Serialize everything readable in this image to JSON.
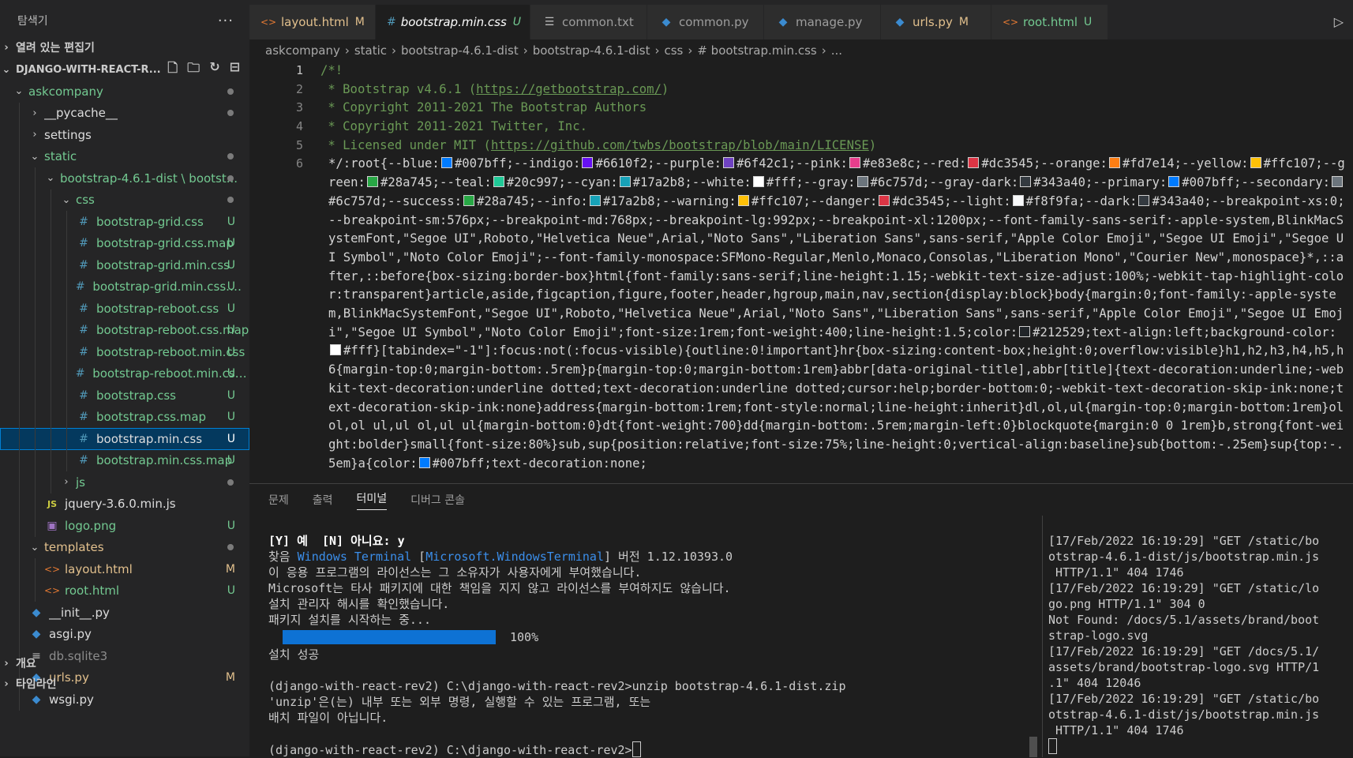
{
  "explorer": {
    "title": "탐색기",
    "more": "···",
    "open_editors": "열려 있는 편집기",
    "project": "DJANGO-WITH-REACT-R...",
    "outline": "개요",
    "timeline": "타임라인"
  },
  "tree": [
    {
      "label": "askcompany",
      "depth": 0,
      "kind": "folder-open",
      "color": "c-green",
      "status": "dot"
    },
    {
      "label": "__pycache__",
      "depth": 1,
      "kind": "folder",
      "color": "c-white",
      "status": "dot"
    },
    {
      "label": "settings",
      "depth": 1,
      "kind": "folder",
      "color": "c-white",
      "status": ""
    },
    {
      "label": "static",
      "depth": 1,
      "kind": "folder-open",
      "color": "c-green",
      "status": "dot"
    },
    {
      "label": "bootstrap-4.6.1-dist \\ bootst...",
      "depth": 2,
      "kind": "folder-open",
      "color": "c-green",
      "status": "dot"
    },
    {
      "label": "css",
      "depth": 3,
      "kind": "folder-open",
      "color": "c-green",
      "status": "dot"
    },
    {
      "label": "bootstrap-grid.css",
      "depth": 4,
      "kind": "css",
      "color": "c-green",
      "status": "U"
    },
    {
      "label": "bootstrap-grid.css.map",
      "depth": 4,
      "kind": "css",
      "color": "c-green",
      "status": "U"
    },
    {
      "label": "bootstrap-grid.min.css",
      "depth": 4,
      "kind": "css",
      "color": "c-green",
      "status": "U"
    },
    {
      "label": "bootstrap-grid.min.css.map",
      "depth": 4,
      "kind": "css",
      "color": "c-green",
      "status": "U"
    },
    {
      "label": "bootstrap-reboot.css",
      "depth": 4,
      "kind": "css",
      "color": "c-green",
      "status": "U"
    },
    {
      "label": "bootstrap-reboot.css.map",
      "depth": 4,
      "kind": "css",
      "color": "c-green",
      "status": "U"
    },
    {
      "label": "bootstrap-reboot.min.css",
      "depth": 4,
      "kind": "css",
      "color": "c-green",
      "status": "U"
    },
    {
      "label": "bootstrap-reboot.min.css....",
      "depth": 4,
      "kind": "css",
      "color": "c-green",
      "status": "U"
    },
    {
      "label": "bootstrap.css",
      "depth": 4,
      "kind": "css",
      "color": "c-green",
      "status": "U"
    },
    {
      "label": "bootstrap.css.map",
      "depth": 4,
      "kind": "css",
      "color": "c-green",
      "status": "U"
    },
    {
      "label": "bootstrap.min.css",
      "depth": 4,
      "kind": "css",
      "color": "c-white",
      "status": "U",
      "selected": true
    },
    {
      "label": "bootstrap.min.css.map",
      "depth": 4,
      "kind": "css",
      "color": "c-green",
      "status": "U"
    },
    {
      "label": "js",
      "depth": 3,
      "kind": "folder",
      "color": "c-green",
      "status": "dot"
    },
    {
      "label": "jquery-3.6.0.min.js",
      "depth": 2,
      "kind": "js",
      "color": "c-white",
      "status": ""
    },
    {
      "label": "logo.png",
      "depth": 2,
      "kind": "img",
      "color": "c-green",
      "status": "U"
    },
    {
      "label": "templates",
      "depth": 1,
      "kind": "folder-open",
      "color": "c-gold",
      "status": "dot"
    },
    {
      "label": "layout.html",
      "depth": 2,
      "kind": "html",
      "color": "c-gold",
      "status": "M"
    },
    {
      "label": "root.html",
      "depth": 2,
      "kind": "html",
      "color": "c-green",
      "status": "U"
    },
    {
      "label": "__init__.py",
      "depth": 1,
      "kind": "py",
      "color": "c-white",
      "status": ""
    },
    {
      "label": "asgi.py",
      "depth": 1,
      "kind": "py",
      "color": "c-white",
      "status": ""
    },
    {
      "label": "db.sqlite3",
      "depth": 1,
      "kind": "db",
      "color": "c-dim",
      "status": ""
    },
    {
      "label": "urls.py",
      "depth": 1,
      "kind": "py",
      "color": "c-gold",
      "status": "M"
    },
    {
      "label": "wsgi.py",
      "depth": 1,
      "kind": "py",
      "color": "c-white",
      "status": ""
    }
  ],
  "tabs": [
    {
      "label": "layout.html",
      "icon": "html",
      "status": "M",
      "color": "c-gold"
    },
    {
      "label": "bootstrap.min.css",
      "icon": "css",
      "status": "U",
      "color": "c-green",
      "active": true
    },
    {
      "label": "common.txt",
      "icon": "txt",
      "status": "",
      "color": ""
    },
    {
      "label": "common.py",
      "icon": "py",
      "status": "",
      "color": ""
    },
    {
      "label": "manage.py",
      "icon": "py",
      "status": "",
      "color": ""
    },
    {
      "label": "urls.py",
      "icon": "py",
      "status": "M",
      "color": "c-gold"
    },
    {
      "label": "root.html",
      "icon": "html",
      "status": "U",
      "color": "c-green"
    }
  ],
  "breadcrumb": [
    "askcompany",
    "static",
    "bootstrap-4.6.1-dist",
    "bootstrap-4.6.1-dist",
    "css",
    "# bootstrap.min.css",
    "..."
  ],
  "editor": {
    "line_numbers": [
      "1",
      "2",
      "3",
      "4",
      "5",
      "6"
    ],
    "comment_lines": [
      {
        "pre": "/*!",
        "url": "",
        "post": ""
      },
      {
        "pre": " * Bootstrap v4.6.1 (",
        "url": "https://getbootstrap.com/",
        "post": ")"
      },
      {
        "pre": " * Copyright 2011-2021 The Bootstrap Authors",
        "url": "",
        "post": ""
      },
      {
        "pre": " * Copyright 2011-2021 Twitter, Inc.",
        "url": "",
        "post": ""
      },
      {
        "pre": " * Licensed under MIT (",
        "url": "https://github.com/twbs/bootstrap/blob/main/LICENSE",
        "post": ")"
      }
    ],
    "line6": [
      {
        "t": "*/:root{--blue:"
      },
      {
        "c": "#007bff"
      },
      {
        "t": "#007bff;--indigo:"
      },
      {
        "c": "#6610f2"
      },
      {
        "t": "#6610f2;--purple:"
      },
      {
        "c": "#6f42c1"
      },
      {
        "t": "#6f42c1;--pink:"
      },
      {
        "c": "#e83e8c"
      },
      {
        "t": "#e83e8c;--red:"
      },
      {
        "c": "#dc3545"
      },
      {
        "t": "#dc3545;--orange:"
      },
      {
        "c": "#fd7e14"
      },
      {
        "t": "#fd7e14;--yellow:"
      },
      {
        "c": "#ffc107"
      },
      {
        "t": "#ffc107;--green:"
      },
      {
        "c": "#28a745"
      },
      {
        "t": "#28a745;--teal:"
      },
      {
        "c": "#20c997"
      },
      {
        "t": "#20c997;--cyan:"
      },
      {
        "c": "#17a2b8"
      },
      {
        "t": "#17a2b8;--white:"
      },
      {
        "c": "#ffffff"
      },
      {
        "t": "#fff;--gray:"
      },
      {
        "c": "#6c757d"
      },
      {
        "t": "#6c757d;--gray-dark:"
      },
      {
        "c": "#343a40"
      },
      {
        "t": "#343a40;--primary:"
      },
      {
        "c": "#007bff"
      },
      {
        "t": "#007bff;--secondary:"
      },
      {
        "c": "#6c757d"
      },
      {
        "t": "#6c757d;--success:"
      },
      {
        "c": "#28a745"
      },
      {
        "t": "#28a745;--info:"
      },
      {
        "c": "#17a2b8"
      },
      {
        "t": "#17a2b8;--warning:"
      },
      {
        "c": "#ffc107"
      },
      {
        "t": "#ffc107;--danger:"
      },
      {
        "c": "#dc3545"
      },
      {
        "t": "#dc3545;--light:"
      },
      {
        "c": "#f8f9fa"
      },
      {
        "t": "#f8f9fa;--dark:"
      },
      {
        "c": "#343a40"
      },
      {
        "t": "#343a40;--breakpoint-xs:0;--breakpoint-sm:576px;--breakpoint-md:768px;--breakpoint-lg:992px;--breakpoint-xl:1200px;--font-family-sans-serif:-apple-system,BlinkMacSystemFont,\"Segoe UI\",Roboto,\"Helvetica Neue\",Arial,\"Noto Sans\",\"Liberation Sans\",sans-serif,\"Apple Color Emoji\",\"Segoe UI Emoji\",\"Segoe UI Symbol\",\"Noto Color Emoji\";--font-family-monospace:SFMono-Regular,Menlo,Monaco,Consolas,\"Liberation Mono\",\"Courier New\",monospace}*,::after,::before{box-sizing:border-box}html{font-family:sans-serif;line-height:1.15;-webkit-text-size-adjust:100%;-webkit-tap-highlight-color:transparent}article,aside,figcaption,figure,footer,header,hgroup,main,nav,section{display:block}body{margin:0;font-family:-apple-system,BlinkMacSystemFont,\"Segoe UI\",Roboto,\"Helvetica Neue\",Arial,\"Noto Sans\",\"Liberation Sans\",sans-serif,\"Apple Color Emoji\",\"Segoe UI Emoji\",\"Segoe UI Symbol\",\"Noto Color Emoji\";font-size:1rem;font-weight:400;line-height:1.5;color:"
      },
      {
        "c": "#212529"
      },
      {
        "t": "#212529;text-align:left;background-color:"
      },
      {
        "c": "#ffffff"
      },
      {
        "t": "#fff}[tabindex=\"-1\"]:focus:not(:focus-visible){outline:0!important}hr{box-sizing:content-box;height:0;overflow:visible}h1,h2,h3,h4,h5,h6{margin-top:0;margin-bottom:.5rem}p{margin-top:0;margin-bottom:1rem}abbr[data-original-title],abbr[title]{text-decoration:underline;-webkit-text-decoration:underline dotted;text-decoration:underline dotted;cursor:help;border-bottom:0;-webkit-text-decoration-skip-ink:none;text-decoration-skip-ink:none}address{margin-bottom:1rem;font-style:normal;line-height:inherit}dl,ol,ul{margin-top:0;margin-bottom:1rem}ol ol,ol ul,ul ol,ul ul{margin-bottom:0}dt{font-weight:700}dd{margin-bottom:.5rem;margin-left:0}blockquote{margin:0 0 1rem}b,strong{font-weight:bolder}small{font-size:80%}sub,sup{position:relative;font-size:75%;line-height:0;vertical-align:baseline}sub{bottom:-.25em}sup{top:-.5em}a{color:"
      },
      {
        "c": "#007bff"
      },
      {
        "t": "#007bff;text-decoration:none;"
      }
    ]
  },
  "panel": {
    "tabs": [
      "문제",
      "출력",
      "터미널",
      "디버그 콘솔"
    ],
    "active_tab": "터미널",
    "terminal_left": {
      "line1": "[Y] 예  [N] 아니요: y",
      "line2": {
        "a": "찾음 ",
        "b": "Windows Terminal",
        "c": " [",
        "d": "Microsoft.WindowsTerminal",
        "e": "] 버전 1.12.10393.0"
      },
      "line3": "이 응용 프로그램의 라이선스는 그 소유자가 사용자에게 부여했습니다.",
      "line4": "Microsoft는 타사 패키지에 대한 책임을 지지 않고 라이선스를 부여하지도 않습니다.",
      "line5": "설치 관리자 해시를 확인했습니다.",
      "line6": "패키지 설치를 시작하는 중...",
      "progress_percent": 100,
      "progress_text": "100%",
      "line7": "설치 성공",
      "line8": "",
      "line9": "(django-with-react-rev2) C:\\django-with-react-rev2>unzip bootstrap-4.6.1-dist.zip",
      "line10": "'unzip'은(는) 내부 또는 외부 명령, 실행할 수 있는 프로그램, 또는",
      "line11": "배치 파일이 아닙니다.",
      "line12": "",
      "prompt": "(django-with-react-rev2) C:\\django-with-react-rev2>"
    },
    "terminal_right": [
      "[17/Feb/2022 16:19:29] \"GET /static/bo",
      "otstrap-4.6.1-dist/js/bootstrap.min.js",
      " HTTP/1.1\" 404 1746",
      "[17/Feb/2022 16:19:29] \"GET /static/lo",
      "go.png HTTP/1.1\" 304 0",
      "Not Found: /docs/5.1/assets/brand/boot",
      "strap-logo.svg",
      "[17/Feb/2022 16:19:29] \"GET /docs/5.1/",
      "assets/brand/bootstrap-logo.svg HTTP/1",
      ".1\" 404 12046",
      "[17/Feb/2022 16:19:29] \"GET /static/bo",
      "otstrap-4.6.1-dist/js/bootstrap.min.js",
      " HTTP/1.1\" 404 1746"
    ]
  }
}
